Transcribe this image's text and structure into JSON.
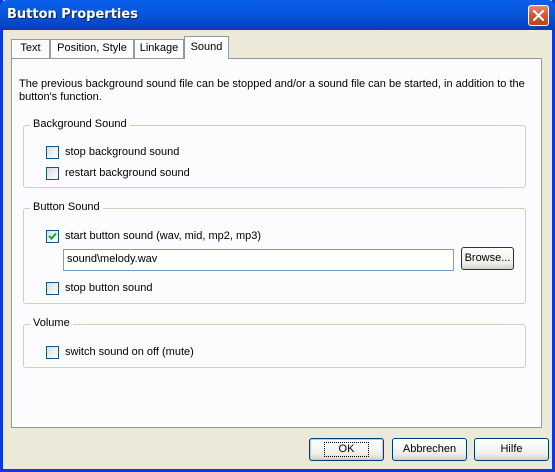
{
  "window": {
    "title": "Button Properties"
  },
  "tabs": [
    {
      "label": "Text"
    },
    {
      "label": "Position, Style"
    },
    {
      "label": "Linkage"
    },
    {
      "label": "Sound",
      "active": true
    }
  ],
  "description": "The previous background sound file can be stopped and/or a sound file can be started, in addition to the button's function.",
  "background_sound": {
    "legend": "Background Sound",
    "stop_label": "stop background sound",
    "stop_checked": false,
    "restart_label": "restart background sound",
    "restart_checked": false
  },
  "button_sound": {
    "legend": "Button Sound",
    "start_label": "start button sound (wav, mid, mp2, mp3)",
    "start_checked": true,
    "file_value": "sound\\melody.wav",
    "browse_label": "Browse...",
    "stop_label": "stop button sound",
    "stop_checked": false
  },
  "volume": {
    "legend": "Volume",
    "mute_label": "switch sound on off (mute)",
    "mute_checked": false
  },
  "footer": {
    "ok_label": "OK",
    "cancel_label": "Abbrechen",
    "help_label": "Hilfe"
  },
  "icons": {
    "close": "close-icon",
    "check": "checkmark-icon"
  },
  "colors": {
    "titlebar": "#0a5fe8",
    "close_button": "#d9532e",
    "dialog_bg": "#ece9d8"
  }
}
